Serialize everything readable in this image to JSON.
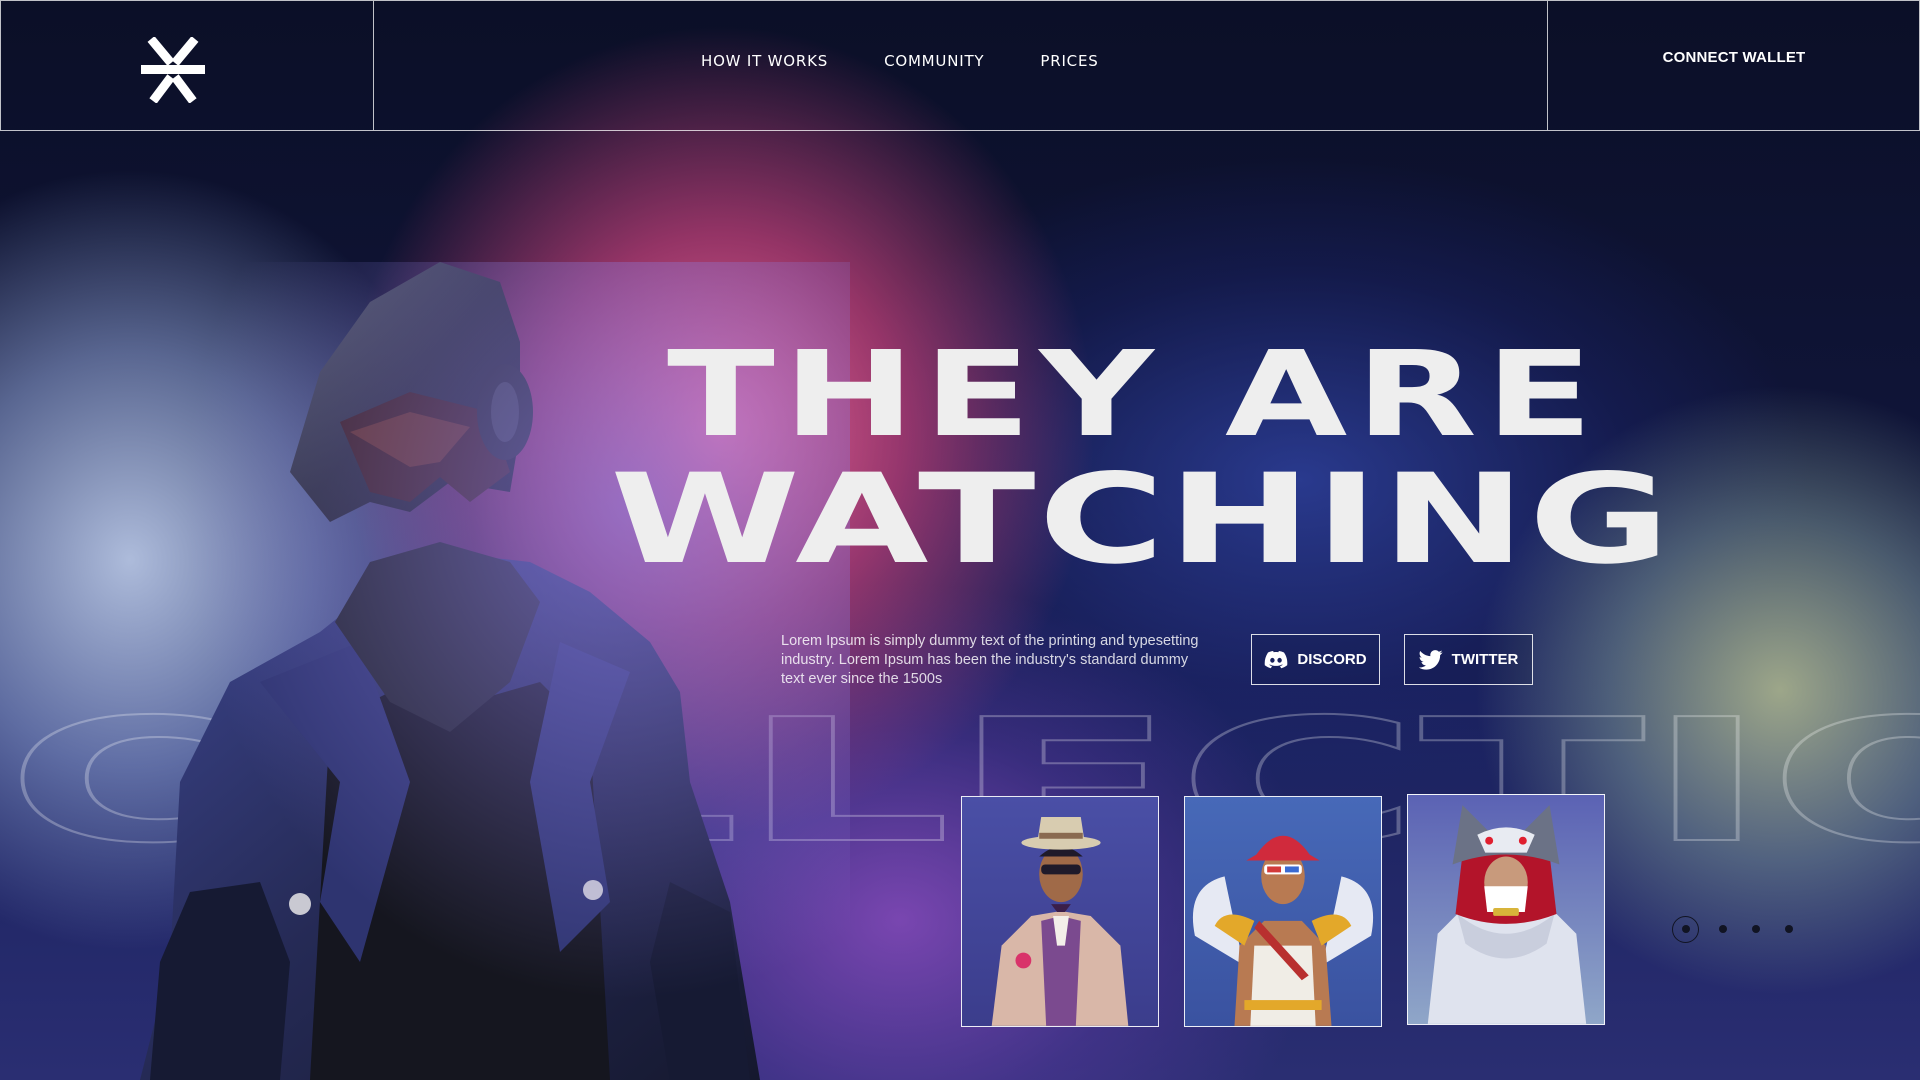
{
  "header": {
    "nav": {
      "how_it_works": "HOW IT WORKS",
      "community": "COMMUNITY",
      "prices": "PRICES"
    },
    "connect_wallet": "CONNECT WALLET"
  },
  "hero": {
    "headline_line1": "THEY ARE",
    "headline_line2": "WATCHING",
    "description": "Lorem Ipsum is simply dummy text of the printing and typesetting industry. Lorem Ipsum has been the industry's standard dummy text ever since the 1500s",
    "background_word": "COLLECTION"
  },
  "social": {
    "discord_label": "DISCORD",
    "twitter_label": "TWITTER"
  },
  "carousel": {
    "page_count": 4,
    "active_page": 1
  },
  "colors": {
    "text": "#ffffff",
    "navy": "#0b0f27",
    "pink": "#ff6ea0",
    "dot": "#111423"
  }
}
